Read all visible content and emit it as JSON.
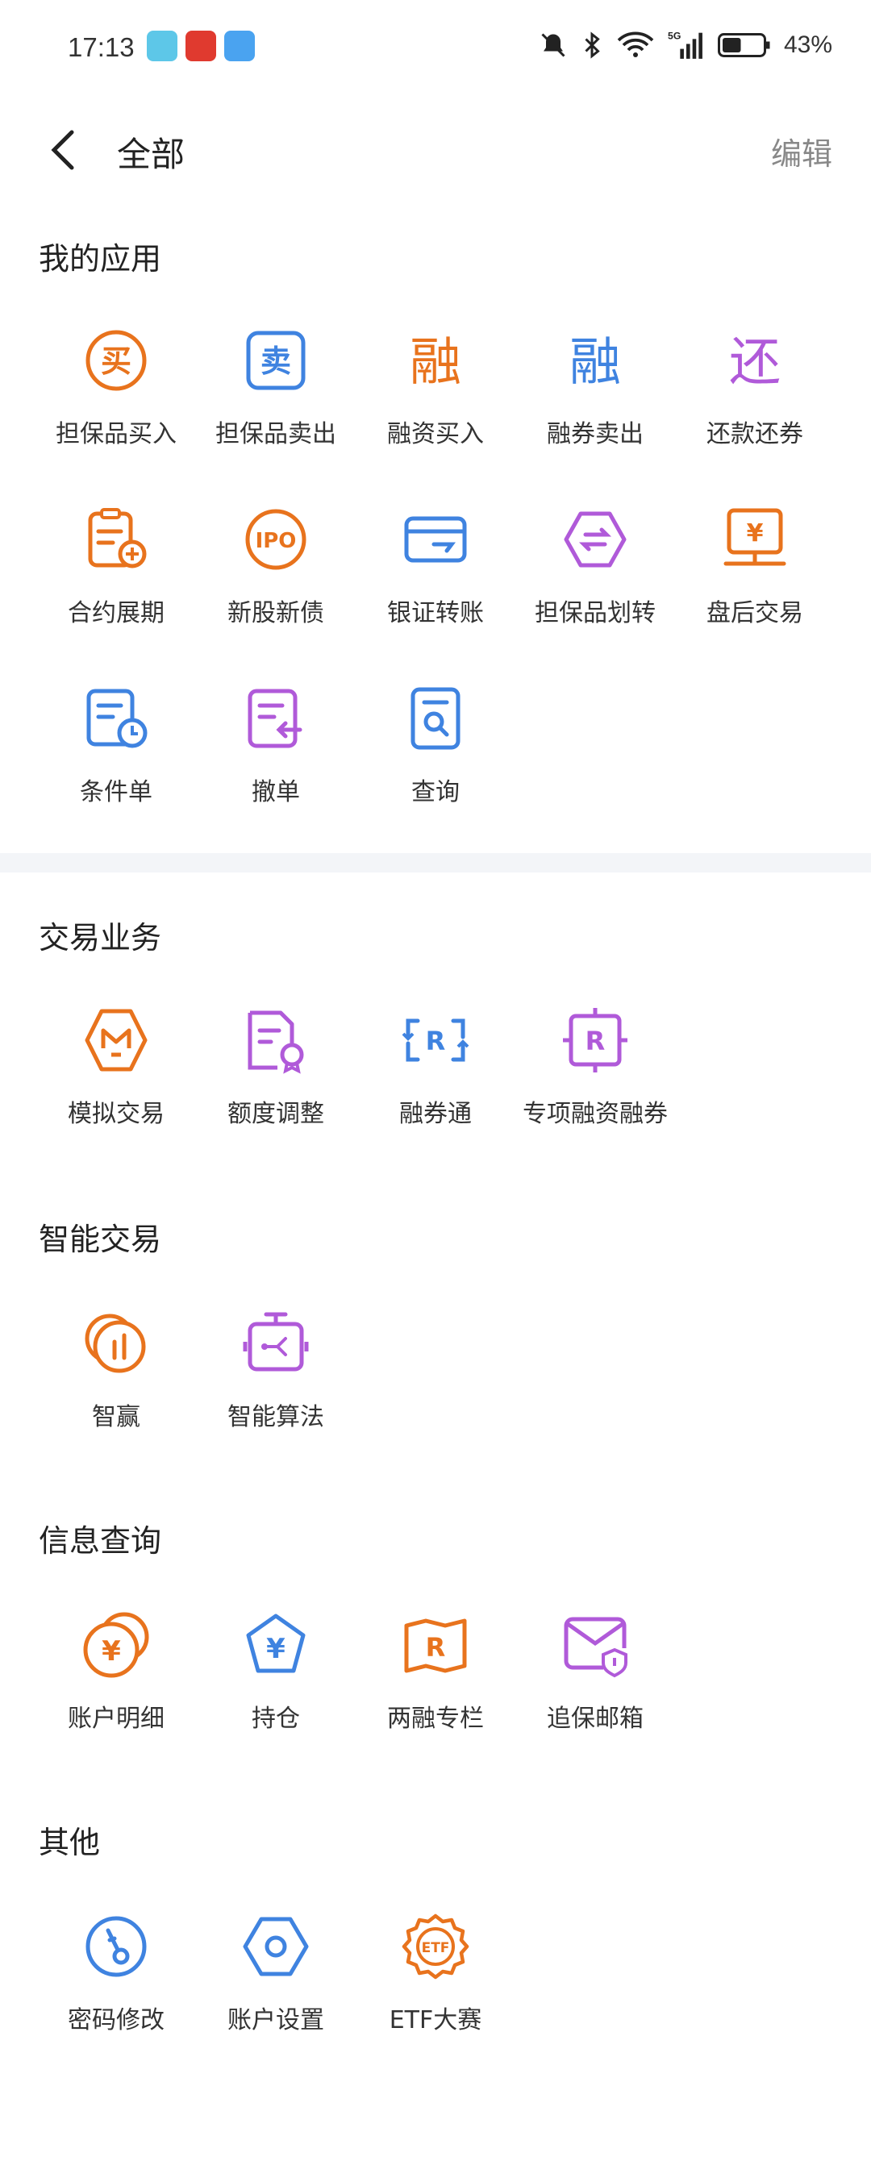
{
  "status_bar": {
    "time": "17:13",
    "battery": "43%",
    "network": "5G"
  },
  "nav": {
    "title": "全部",
    "edit_label": "编辑"
  },
  "colors": {
    "orange": "#e8731d",
    "blue": "#3f83e0",
    "purple": "#b05ad9"
  },
  "sections": {
    "my_apps": {
      "title": "我的应用",
      "items": [
        {
          "label": "担保品买入",
          "icon": "buy-icon"
        },
        {
          "label": "担保品卖出",
          "icon": "sell-icon"
        },
        {
          "label": "融资买入",
          "icon": "rong-icon"
        },
        {
          "label": "融券卖出",
          "icon": "rong-icon"
        },
        {
          "label": "还款还券",
          "icon": "repay-icon"
        },
        {
          "label": "合约展期",
          "icon": "contract-extend-icon"
        },
        {
          "label": "新股新债",
          "icon": "ipo-icon"
        },
        {
          "label": "银证转账",
          "icon": "card-transfer-icon"
        },
        {
          "label": "担保品划转",
          "icon": "transfer-icon"
        },
        {
          "label": "盘后交易",
          "icon": "after-hours-icon"
        },
        {
          "label": "条件单",
          "icon": "condition-order-icon"
        },
        {
          "label": "撤单",
          "icon": "cancel-order-icon"
        },
        {
          "label": "查询",
          "icon": "query-icon"
        }
      ]
    },
    "trade": {
      "title": "交易业务",
      "items": [
        {
          "label": "模拟交易",
          "icon": "simulate-icon"
        },
        {
          "label": "额度调整",
          "icon": "quota-adjust-icon"
        },
        {
          "label": "融券通",
          "icon": "rongquantong-icon"
        },
        {
          "label": "专项融资融券",
          "icon": "special-margin-icon"
        }
      ]
    },
    "smart": {
      "title": "智能交易",
      "items": [
        {
          "label": "智赢",
          "icon": "zhiying-icon"
        },
        {
          "label": "智能算法",
          "icon": "algorithm-icon"
        }
      ]
    },
    "info": {
      "title": "信息查询",
      "items": [
        {
          "label": "账户明细",
          "icon": "account-detail-icon"
        },
        {
          "label": "持仓",
          "icon": "position-icon"
        },
        {
          "label": "两融专栏",
          "icon": "margin-column-icon"
        },
        {
          "label": "追保邮箱",
          "icon": "mailbox-icon"
        }
      ]
    },
    "other": {
      "title": "其他",
      "items": [
        {
          "label": "密码修改",
          "icon": "password-key-icon"
        },
        {
          "label": "账户设置",
          "icon": "settings-hex-icon"
        },
        {
          "label": "ETF大赛",
          "icon": "etf-badge-icon"
        }
      ]
    }
  }
}
